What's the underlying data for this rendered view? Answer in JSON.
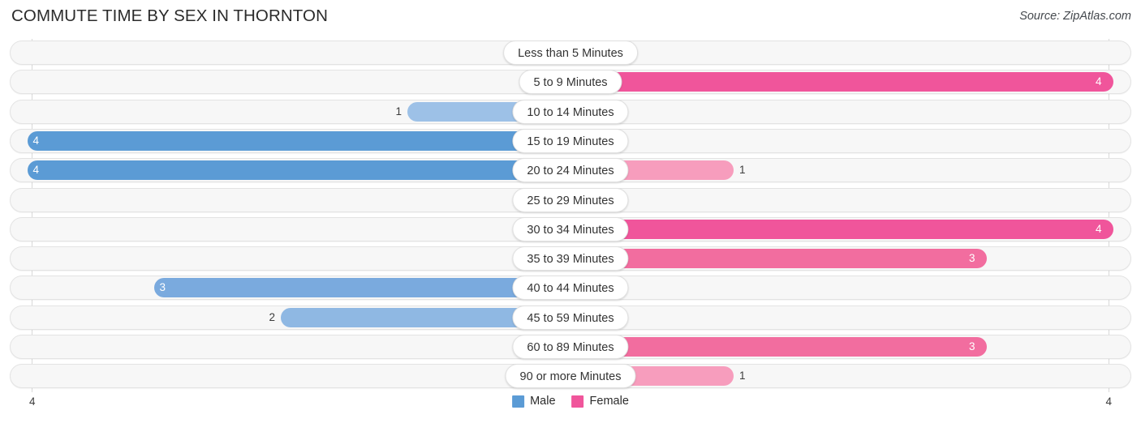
{
  "header": {
    "title": "COMMUTE TIME BY SEX IN THORNTON",
    "source": "Source: ZipAtlas.com"
  },
  "axis": {
    "left_tick": "4",
    "right_tick": "4"
  },
  "legend": {
    "items": [
      {
        "label": "Male",
        "color": "#5b9bd5"
      },
      {
        "label": "Female",
        "color": "#f0559b"
      }
    ]
  },
  "chart_data": {
    "type": "bar",
    "subtype": "diverging-horizontal-bar",
    "title": "COMMUTE TIME BY SEX IN THORNTON",
    "source": "Source: ZipAtlas.com",
    "xlabel": "",
    "ylabel": "",
    "categories": [
      "Less than 5 Minutes",
      "5 to 9 Minutes",
      "10 to 14 Minutes",
      "15 to 19 Minutes",
      "20 to 24 Minutes",
      "25 to 29 Minutes",
      "30 to 34 Minutes",
      "35 to 39 Minutes",
      "40 to 44 Minutes",
      "45 to 59 Minutes",
      "60 to 89 Minutes",
      "90 or more Minutes"
    ],
    "series": [
      {
        "name": "Male",
        "color": "#5b9bd5",
        "direction": "left",
        "values": [
          0,
          0,
          1,
          4,
          4,
          0,
          0,
          0,
          3,
          2,
          0,
          0
        ],
        "labels": [
          "0",
          "0",
          "1",
          "4",
          "4",
          "0",
          "0",
          "0",
          "3",
          "2",
          "0",
          "0"
        ]
      },
      {
        "name": "Female",
        "color": "#f0559b",
        "direction": "right",
        "values": [
          0,
          4,
          0,
          0,
          1,
          0,
          4,
          3,
          0,
          0,
          3,
          1
        ],
        "labels": [
          "0",
          "4",
          "0",
          "0",
          "1",
          "0",
          "4",
          "3",
          "0",
          "0",
          "3",
          "1"
        ]
      }
    ],
    "xlim": [
      4,
      0,
      4
    ],
    "axis_ticks": [
      "4",
      "4"
    ],
    "grid": false,
    "legend_position": "bottom-center"
  },
  "style": {
    "male_scale": [
      "#a8c8ea",
      "#9dc1e7",
      "#8fb8e3",
      "#7aaade",
      "#5b9bd5"
    ],
    "female_scale": [
      "#f7a8c4",
      "#f79dbd",
      "#f685b0",
      "#f26d9f",
      "#f0559b"
    ],
    "track_fill": "#f7f7f7",
    "track_border": "#e3e3e3",
    "axis_line": "#d8d8d8"
  }
}
